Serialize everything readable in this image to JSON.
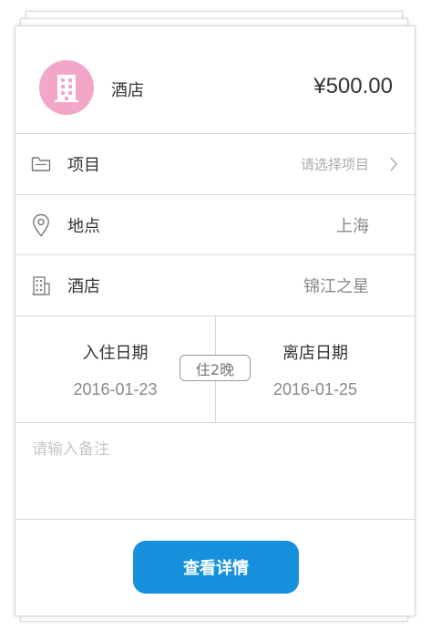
{
  "header": {
    "icon": "hotel-building-icon",
    "avatar_color": "#f2a7c8",
    "title": "酒店",
    "price": "¥500.00"
  },
  "rows": {
    "project": {
      "icon": "folder-icon",
      "label": "项目",
      "value": "请选择项目",
      "chevron": "chevron-right-icon"
    },
    "location": {
      "icon": "location-pin-icon",
      "label": "地点",
      "value": "上海"
    },
    "hotel": {
      "icon": "building-icon",
      "label": "酒店",
      "value": "锦江之星"
    }
  },
  "dates": {
    "checkin_label": "入住日期",
    "checkin_value": "2016-01-23",
    "nights": "住2晚",
    "checkout_label": "离店日期",
    "checkout_value": "2016-01-25"
  },
  "notes": {
    "placeholder": "请输入备注",
    "value": ""
  },
  "button": {
    "label": "查看详情",
    "color": "#1791de"
  }
}
